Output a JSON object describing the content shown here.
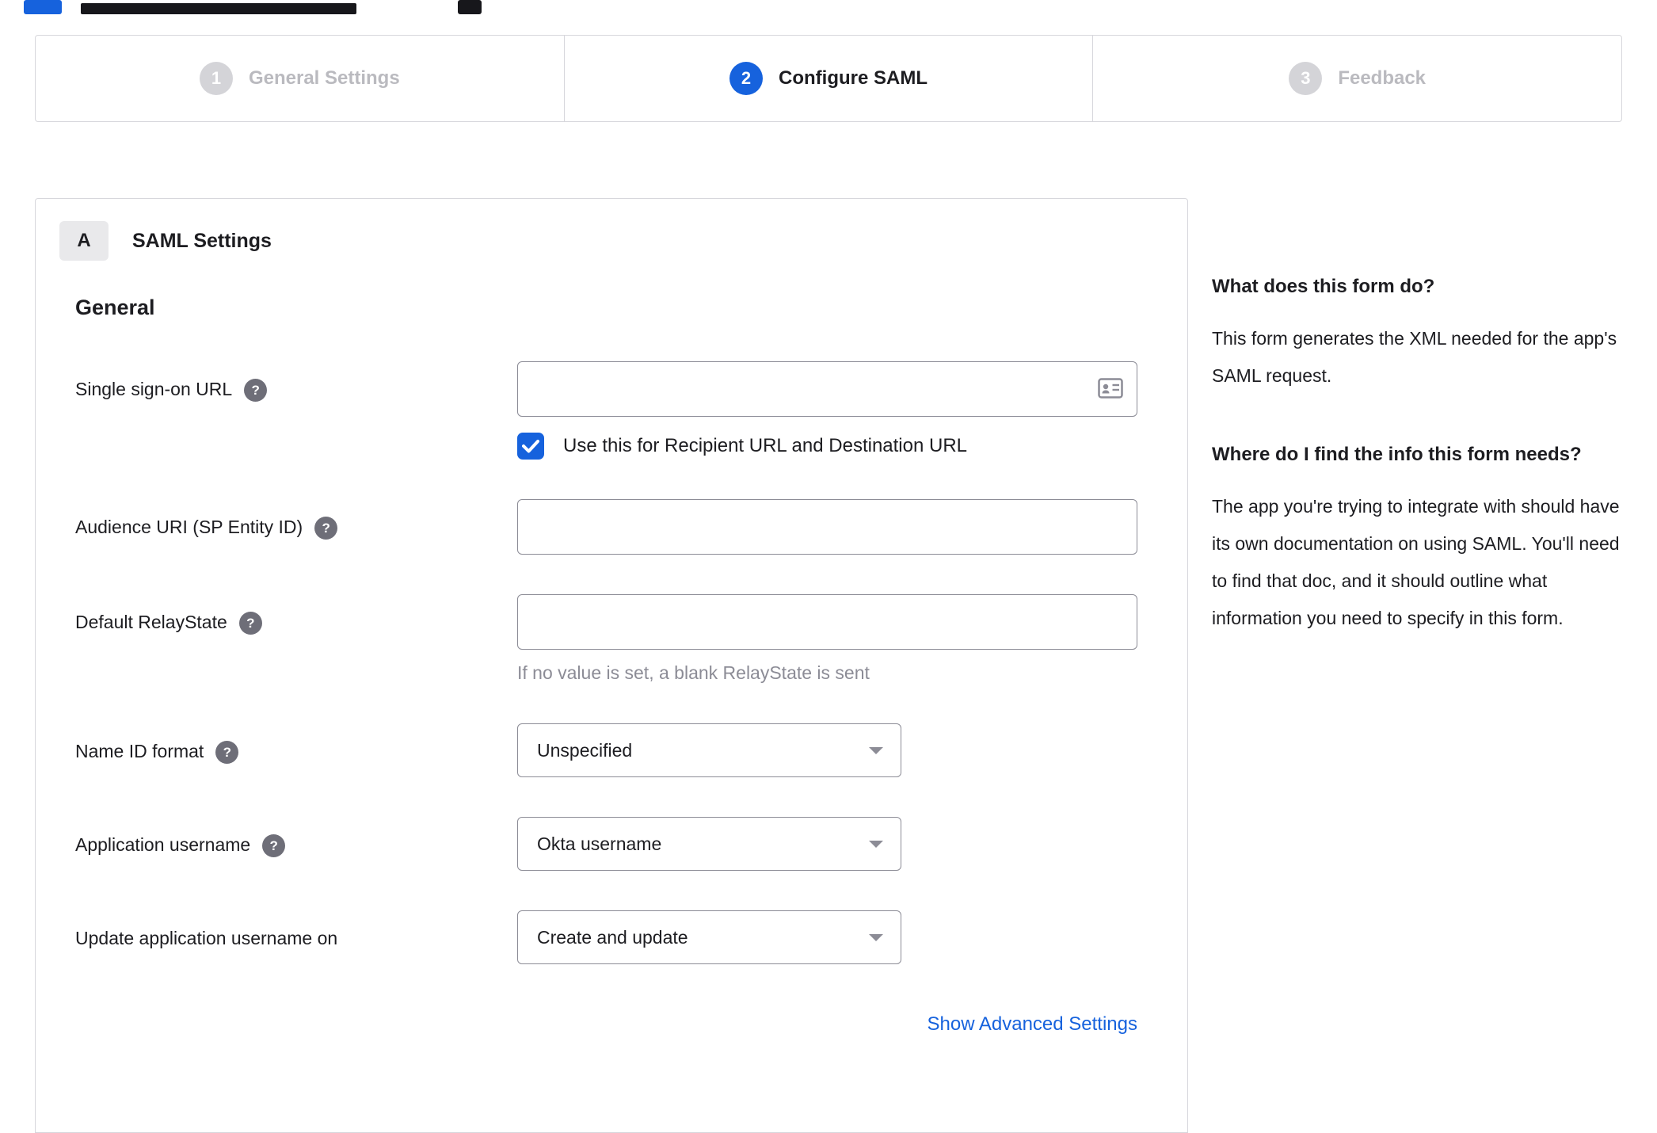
{
  "accent": "#1662dd",
  "stepper": {
    "steps": [
      {
        "number": "1",
        "label": "General Settings"
      },
      {
        "number": "2",
        "label": "Configure SAML"
      },
      {
        "number": "3",
        "label": "Feedback"
      }
    ]
  },
  "panel": {
    "badge": "A",
    "title": "SAML Settings",
    "section": "General",
    "advanced_link": "Show Advanced Settings"
  },
  "form": {
    "sso": {
      "label": "Single sign-on URL",
      "value": "",
      "checkbox_label": "Use this for Recipient URL and Destination URL",
      "checked": true
    },
    "audience": {
      "label": "Audience URI (SP Entity ID)",
      "value": ""
    },
    "relay": {
      "label": "Default RelayState",
      "value": "",
      "helper": "If no value is set, a blank RelayState is sent"
    },
    "nameid": {
      "label": "Name ID format",
      "value": "Unspecified"
    },
    "appuser": {
      "label": "Application username",
      "value": "Okta username"
    },
    "update": {
      "label": "Update application username on",
      "value": "Create and update"
    }
  },
  "sidebar": {
    "q1": "What does this form do?",
    "a1": "This form generates the XML needed for the app's SAML request.",
    "q2": "Where do I find the info this form needs?",
    "a2": "The app you're trying to integrate with should have its own documentation on using SAML. You'll need to find that doc, and it should outline what information you need to specify in this form."
  }
}
